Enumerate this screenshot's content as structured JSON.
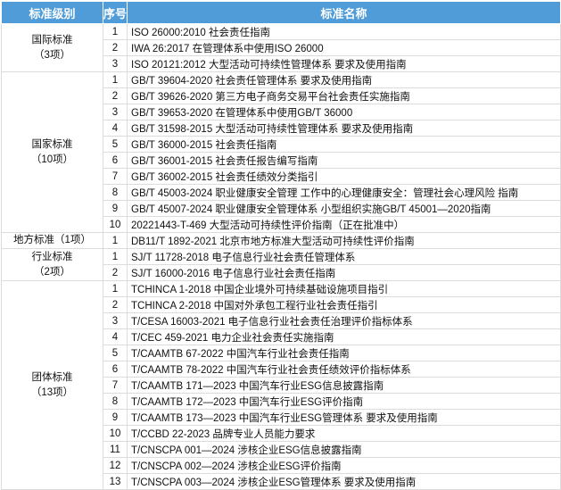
{
  "headers": {
    "level": "标准级别",
    "no": "序号",
    "name": "标准名称"
  },
  "groups": [
    {
      "level": "国际标准",
      "count": "（3项）",
      "rows": [
        [
          "1",
          "ISO 26000:2010 社会责任指南"
        ],
        [
          "2",
          "IWA 26:2017 在管理体系中使用ISO 26000"
        ],
        [
          "3",
          "ISO 20121:2012 大型活动可持续性管理体系 要求及使用指南"
        ]
      ]
    },
    {
      "level": "国家标准",
      "count": "（10项）",
      "rows": [
        [
          "1",
          "GB/T 39604-2020 社会责任管理体系 要求及使用指南"
        ],
        [
          "2",
          "GB/T 39626-2020 第三方电子商务交易平台社会责任实施指南"
        ],
        [
          "3",
          "GB/T 39653-2020 在管理体系中使用GB/T 36000"
        ],
        [
          "4",
          "GB/T 31598-2015 大型活动可持续性管理体系 要求及使用指南"
        ],
        [
          "5",
          "GB/T 36000-2015 社会责任指南"
        ],
        [
          "6",
          "GB/T 36001-2015 社会责任报告编写指南"
        ],
        [
          "7",
          "GB/T 36002-2015 社会责任绩效分类指引"
        ],
        [
          "8",
          "GB/T 45003-2024 职业健康安全管理 工作中的心理健康安全：管理社会心理风险 指南"
        ],
        [
          "9",
          "GB/T 45007-2024 职业健康安全管理体系 小型组织实施GB/T 45001—2020指南"
        ],
        [
          "10",
          "20221443-T-469 大型活动可持续性评价指南（正在批准中）"
        ]
      ]
    },
    {
      "level": "地方标准（1项）",
      "count": "",
      "rows": [
        [
          "1",
          "DB11/T 1892-2021 北京市地方标准大型活动可持续性评价指南"
        ]
      ]
    },
    {
      "level": "行业标准",
      "count": "（2项）",
      "rows": [
        [
          "1",
          "SJ/T 11728-2018 电子信息行业社会责任管理体系"
        ],
        [
          "2",
          "SJ/T 16000-2016 电子信息行业社会责任指南"
        ]
      ]
    },
    {
      "level": "团体标准",
      "count": "（13项）",
      "rows": [
        [
          "1",
          "TCHINCA 1-2018 中国企业境外可持续基础设施项目指引"
        ],
        [
          "2",
          "TCHINCA 2-2018 中国对外承包工程行业社会责任指引"
        ],
        [
          "3",
          "T/CESA 16003-2021 电子信息行业社会责任治理评价指标体系"
        ],
        [
          "4",
          "T/CEC 459-2021 电力企业社会责任实施指南"
        ],
        [
          "5",
          "T/CAAMTB 67-2022 中国汽车行业社会责任指南"
        ],
        [
          "6",
          "T/CAAMTB 78-2022 中国汽车行业社会责任绩效评价指标体系"
        ],
        [
          "7",
          "T/CAAMTB 171—2023 中国汽车行业ESG信息披露指南"
        ],
        [
          "8",
          "T/CAAMTB 172—2023 中国汽车行业ESG评价指南"
        ],
        [
          "9",
          "T/CAAMTB 173—2023 中国汽车行业ESG管理体系 要求及使用指南"
        ],
        [
          "10",
          "T/CCBD 22-2023 品牌专业人员能力要求"
        ],
        [
          "11",
          "T/CNSCPA 001—2024 涉核企业ESG信息披露指南"
        ],
        [
          "12",
          "T/CNSCPA 002—2024 涉核企业ESG评价指南"
        ],
        [
          "13",
          "T/CNSCPA 003—2024 涉核企业ESG管理体系 要求及使用指南"
        ]
      ]
    }
  ]
}
